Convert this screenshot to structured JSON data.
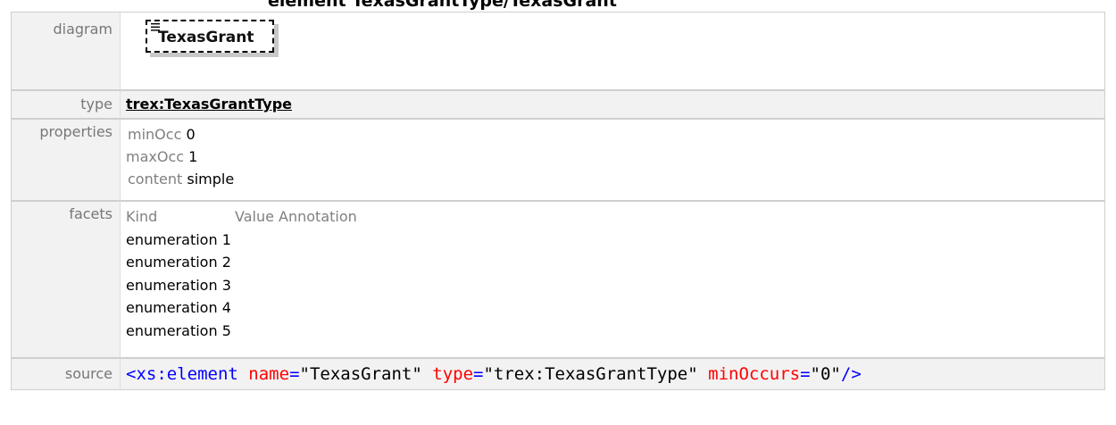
{
  "page": {
    "title": "element TexasGrantType/TexasGrant"
  },
  "diagram": {
    "label": "diagram",
    "element_name": "TexasGrant",
    "icon": "element-content-icon"
  },
  "type_row": {
    "label": "type",
    "value": "trex:TexasGrantType"
  },
  "properties": {
    "label": "properties",
    "items": [
      {
        "key": "minOcc",
        "value": "0"
      },
      {
        "key": "maxOcc",
        "value": "1"
      },
      {
        "key": "content",
        "value": "simple"
      }
    ]
  },
  "facets": {
    "label": "facets",
    "header": {
      "kind": "Kind",
      "value": "Value",
      "annotation": "Annotation"
    },
    "rows": [
      {
        "kind": "enumeration",
        "value": "1"
      },
      {
        "kind": "enumeration",
        "value": "2"
      },
      {
        "kind": "enumeration",
        "value": "3"
      },
      {
        "kind": "enumeration",
        "value": "4"
      },
      {
        "kind": "enumeration",
        "value": "5"
      }
    ]
  },
  "source": {
    "label": "source",
    "tag_open": "<xs:element",
    "attrs": [
      {
        "name": "name",
        "value": "\"TexasGrant\""
      },
      {
        "name": "type",
        "value": "\"trex:TexasGrantType\""
      },
      {
        "name": "minOccurs",
        "value": "\"0\""
      }
    ],
    "tag_close": "/>"
  },
  "colors": {
    "label_bg": "#f2f2f2",
    "label_text": "#777777",
    "border": "#cfcfcf",
    "code_tag": "#0000ff",
    "code_attr": "#ff0000"
  }
}
